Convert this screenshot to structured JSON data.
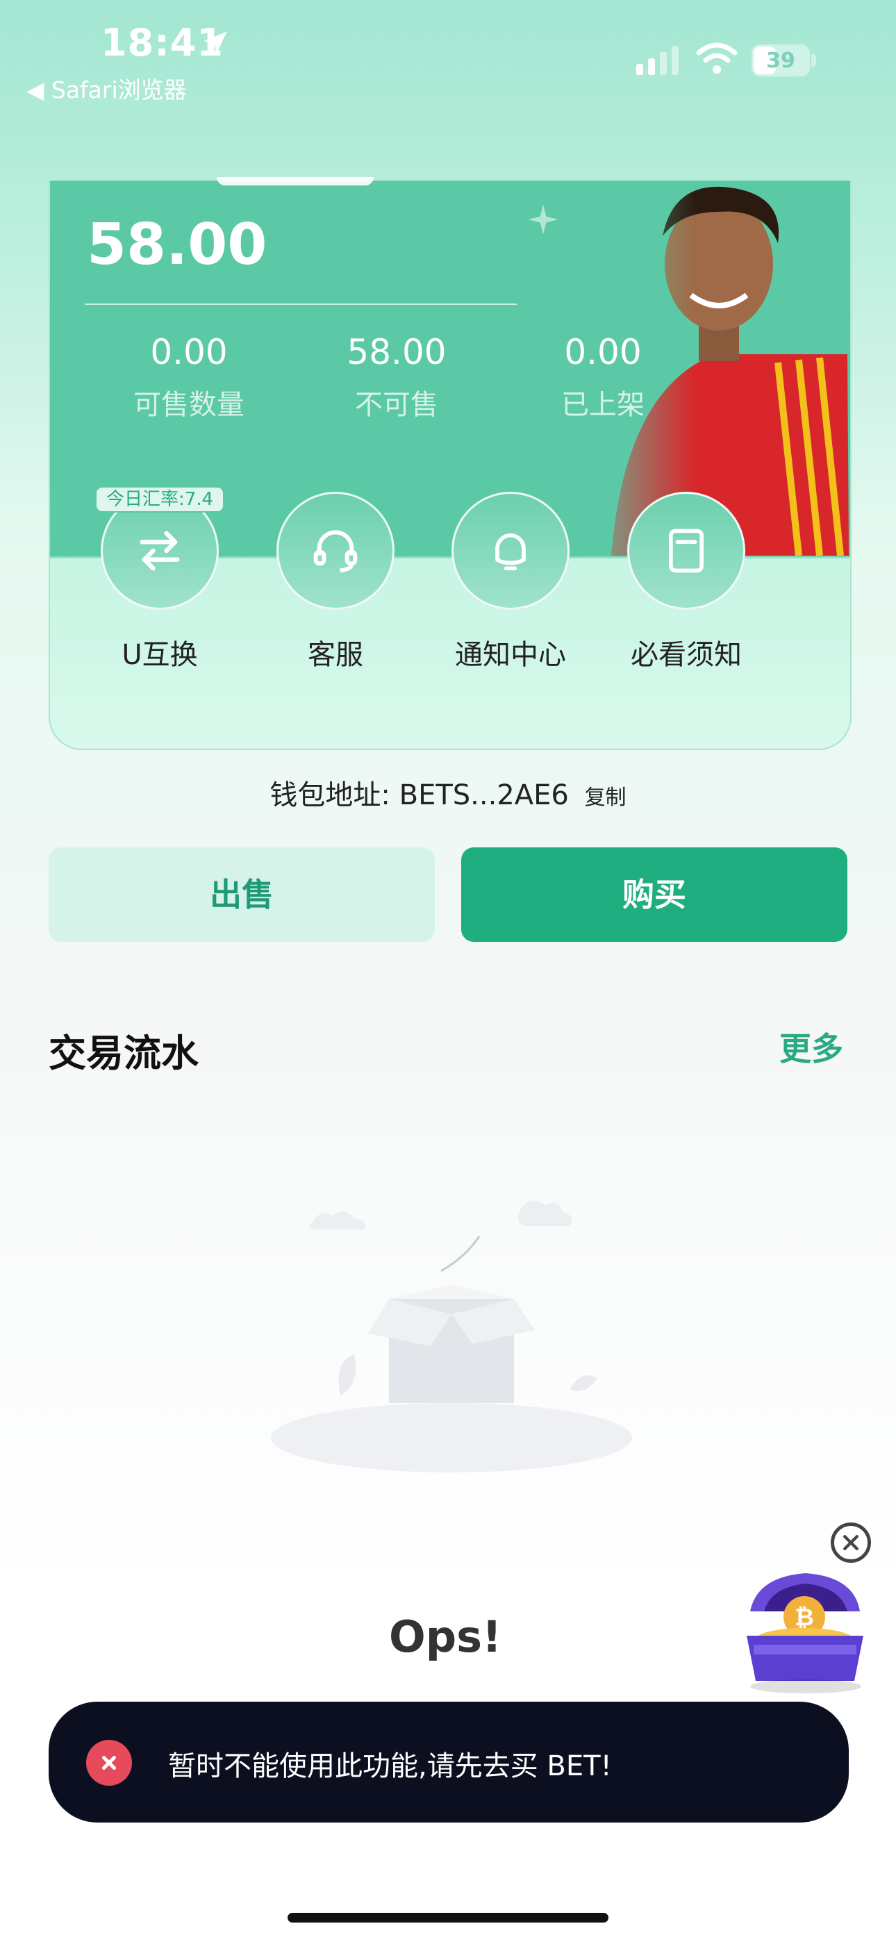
{
  "status_bar": {
    "time": "18:41",
    "back_label": "◀ Safari浏览器",
    "battery": "39"
  },
  "wallet": {
    "balance": "58.00",
    "stats": [
      {
        "value": "0.00",
        "label": "可售数量"
      },
      {
        "value": "58.00",
        "label": "不可售"
      },
      {
        "value": "0.00",
        "label": "已上架"
      }
    ],
    "rate_badge": "今日汇率:7.4",
    "actions": [
      {
        "label": "U互换",
        "icon": "swap-icon"
      },
      {
        "label": "客服",
        "icon": "headset-icon"
      },
      {
        "label": "通知中心",
        "icon": "bell-icon"
      },
      {
        "label": "必看须知",
        "icon": "document-icon"
      }
    ],
    "address_label": "钱包地址:",
    "address": "BETS...2AE6",
    "copy_label": "复制"
  },
  "buttons": {
    "sell": "出售",
    "buy": "购买"
  },
  "transactions": {
    "title": "交易流水",
    "more": "更多",
    "empty_title": "Ops!"
  },
  "toast": {
    "message": "暂时不能使用此功能,请先去买 BET!"
  },
  "colors": {
    "accent": "#1fae7f",
    "card": "#5bc9a6",
    "toast_bg": "#0c0f1f",
    "error": "#e64b5c"
  }
}
